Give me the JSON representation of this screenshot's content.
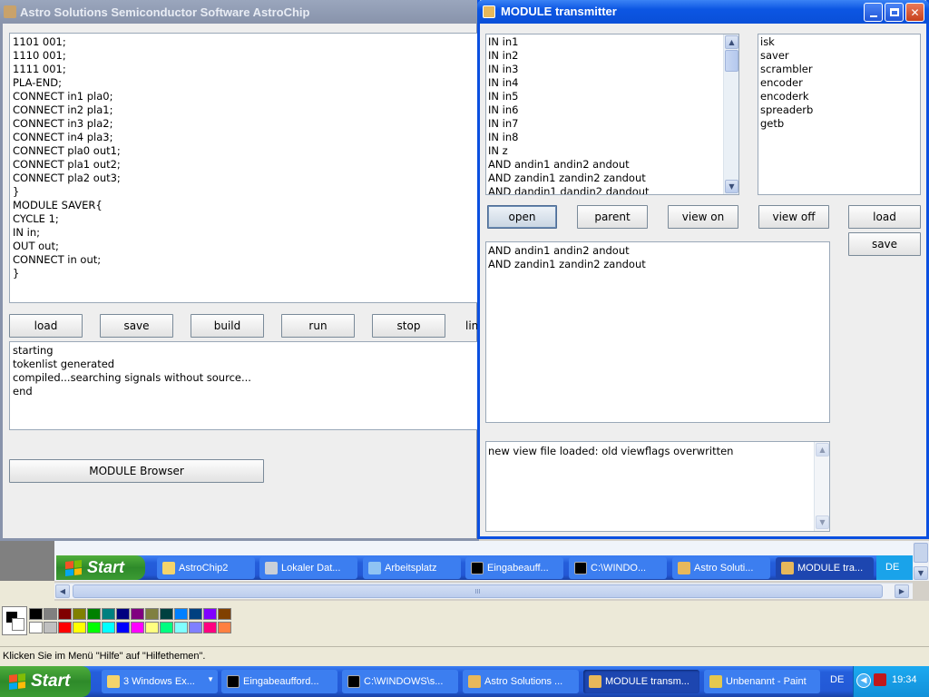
{
  "main_window": {
    "title": "Astro Solutions Semiconductor Software AstroChip",
    "editor_text": "1101 001;\n1110 001;\n1111 001;\nPLA-END;\nCONNECT in1 pla0;\nCONNECT in2 pla1;\nCONNECT in3 pla2;\nCONNECT in4 pla3;\nCONNECT pla0 out1;\nCONNECT pla1 out2;\nCONNECT pla2 out3;\n}\nMODULE SAVER{\nCYCLE 1;\nIN in;\nOUT out;\nCONNECT in out;\n}",
    "buttons": {
      "load": "load",
      "save": "save",
      "build": "build",
      "run": "run",
      "stop": "stop"
    },
    "cut_label": "lin",
    "log_text": "starting\ntokenlist generated\ncompiled...searching signals without source...\nend",
    "module_browser": "MODULE Browser"
  },
  "module_window": {
    "title": "MODULE transmitter",
    "signals": [
      "IN in1",
      "IN in2",
      "IN in3",
      "IN in4",
      "IN in5",
      "IN in6",
      "IN in7",
      "IN in8",
      "IN z",
      "AND andin1 andin2 andout",
      "AND zandin1 zandin2 zandout",
      "AND dandin1 dandin2 dandout"
    ],
    "modules": [
      "isk",
      "saver",
      "scrambler",
      "encoder",
      "encoderk",
      "spreaderb",
      "getb"
    ],
    "buttons": {
      "open": "open",
      "parent": "parent",
      "view_on": "view on",
      "view_off": "view off",
      "load": "load",
      "save": "save"
    },
    "selected_text": "AND andin1 andin2 andout\nAND zandin1 zandin2 zandout",
    "status_text": "new view file loaded: old viewflags overwritten"
  },
  "inner_taskbar": {
    "start": "Start",
    "items": [
      "AstroChip2",
      "Lokaler Dat...",
      "Arbeitsplatz",
      "Eingabeauff...",
      "C:\\WINDO...",
      "Astro Soluti...",
      "MODULE tra..."
    ],
    "lang": "DE"
  },
  "paint": {
    "status": "Klicken Sie im Menü \"Hilfe\" auf \"Hilfethemen\".",
    "palette_top": [
      "#000000",
      "#808080",
      "#800000",
      "#808000",
      "#008000",
      "#008080",
      "#000080",
      "#800080",
      "#808040",
      "#004040",
      "#0080ff",
      "#004080",
      "#8000ff",
      "#804000"
    ],
    "palette_bottom": [
      "#ffffff",
      "#c0c0c0",
      "#ff0000",
      "#ffff00",
      "#00ff00",
      "#00ffff",
      "#0000ff",
      "#ff00ff",
      "#ffff80",
      "#00ff80",
      "#80ffff",
      "#8080ff",
      "#ff0080",
      "#ff8040"
    ],
    "scroll_thumb": "III"
  },
  "taskbar": {
    "start": "Start",
    "items": [
      "3 Windows Ex...",
      "Eingabeaufford...",
      "C:\\WINDOWS\\s...",
      "Astro Solutions ...",
      "MODULE transm...",
      "Unbenannt - Paint"
    ],
    "lang": "DE",
    "clock": "19:34"
  }
}
